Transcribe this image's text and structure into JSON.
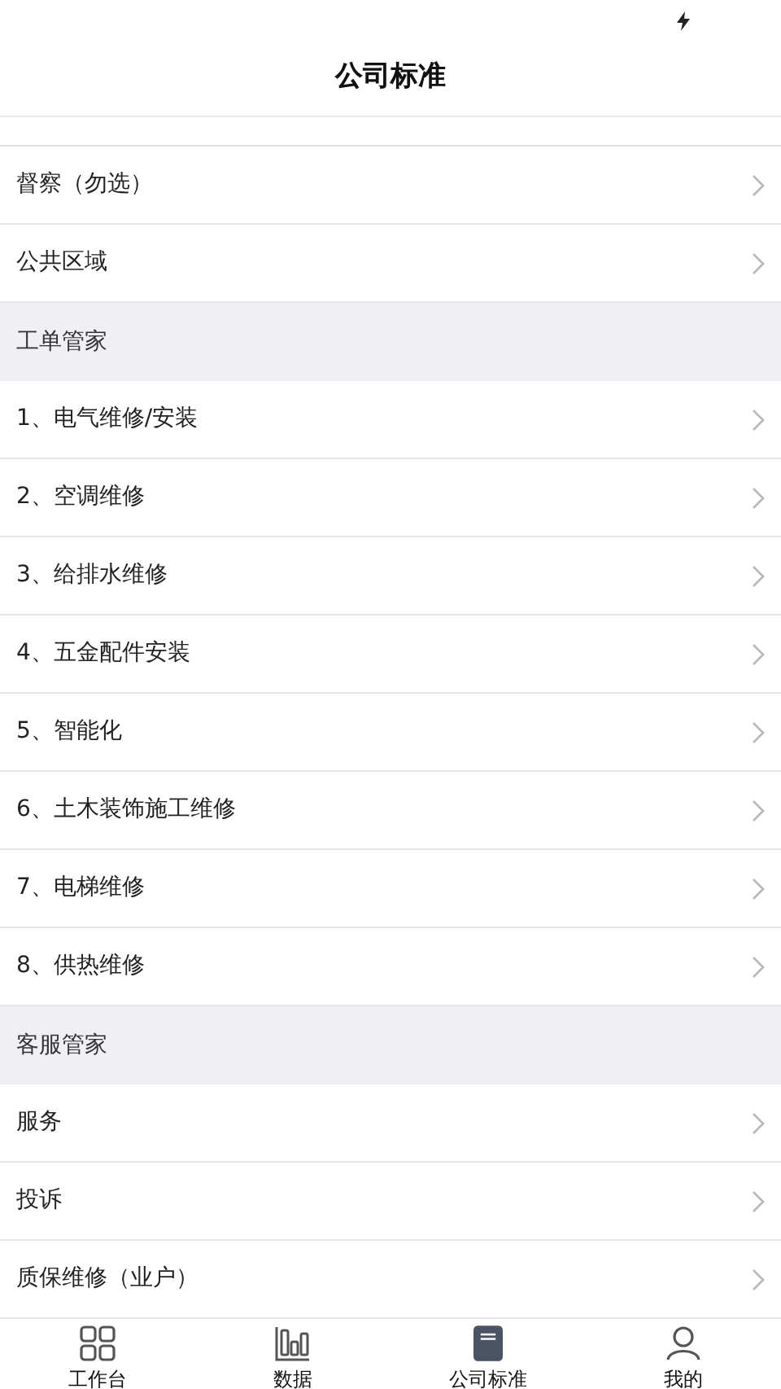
{
  "header": {
    "title": "公司标准"
  },
  "list": [
    {
      "kind": "row",
      "label": "督察（勿选）"
    },
    {
      "kind": "row",
      "label": "公共区域"
    },
    {
      "kind": "header",
      "label": "工单管家"
    },
    {
      "kind": "row",
      "label": "1、电气维修/安装"
    },
    {
      "kind": "row",
      "label": "2、空调维修"
    },
    {
      "kind": "row",
      "label": "3、给排水维修"
    },
    {
      "kind": "row",
      "label": "4、五金配件安装"
    },
    {
      "kind": "row",
      "label": "5、智能化"
    },
    {
      "kind": "row",
      "label": "6、土木装饰施工维修"
    },
    {
      "kind": "row",
      "label": "7、电梯维修"
    },
    {
      "kind": "row",
      "label": "8、供热维修"
    },
    {
      "kind": "header",
      "label": "客服管家"
    },
    {
      "kind": "row",
      "label": "服务"
    },
    {
      "kind": "row",
      "label": "投诉"
    },
    {
      "kind": "row",
      "label": "质保维修（业户）"
    }
  ],
  "tabs": [
    {
      "label": "工作台",
      "selected": false
    },
    {
      "label": "数据",
      "selected": false
    },
    {
      "label": "公司标准",
      "selected": true
    },
    {
      "label": "我的",
      "selected": false
    }
  ]
}
